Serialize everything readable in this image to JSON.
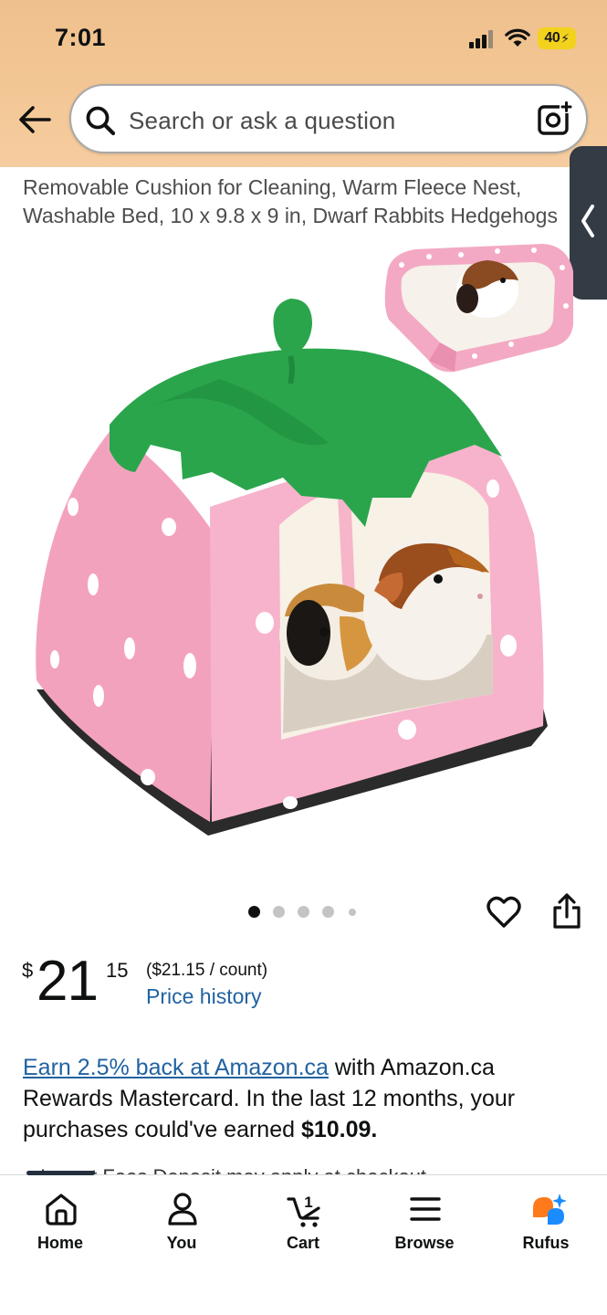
{
  "status_bar": {
    "time": "7:01",
    "battery": "40"
  },
  "search": {
    "placeholder": "Search or ask a question"
  },
  "product": {
    "title_snippet_line1": "Removable Cushion for Cleaning, Warm Fleece Nest,",
    "title_snippet_line2": "Washable Bed, 10 x 9.8 x 9 in, Dwarf Rabbits Hedgehogs"
  },
  "carousel": {
    "total_images": 5,
    "active_index": 0
  },
  "price": {
    "symbol": "$",
    "whole": "21",
    "fraction": "15",
    "unit_price": "($21.15 / count)",
    "history_link": "Price history"
  },
  "rewards": {
    "link_text": "Earn 2.5% back at Amazon.ca",
    "text_part1": " with Amazon.ca Rewards Mastercard. In the last 12 months, your purchases could've earned ",
    "amount": "$10.09."
  },
  "partial_line": "+ Import Fees Deposit may apply at checkout",
  "nav": {
    "items": [
      {
        "label": "Home",
        "icon": "home-icon"
      },
      {
        "label": "You",
        "icon": "person-icon"
      },
      {
        "label": "Cart",
        "icon": "cart-icon",
        "count": "1"
      },
      {
        "label": "Browse",
        "icon": "menu-icon"
      },
      {
        "label": "Rufus",
        "icon": "rufus-icon"
      }
    ]
  },
  "colors": {
    "header_bg": "#f3c795",
    "link": "#2162a1",
    "battery": "#f2d21c",
    "nav_indicator": "#232f3e",
    "rufus_orange": "#ff7a1a",
    "rufus_blue": "#1a8cff"
  }
}
